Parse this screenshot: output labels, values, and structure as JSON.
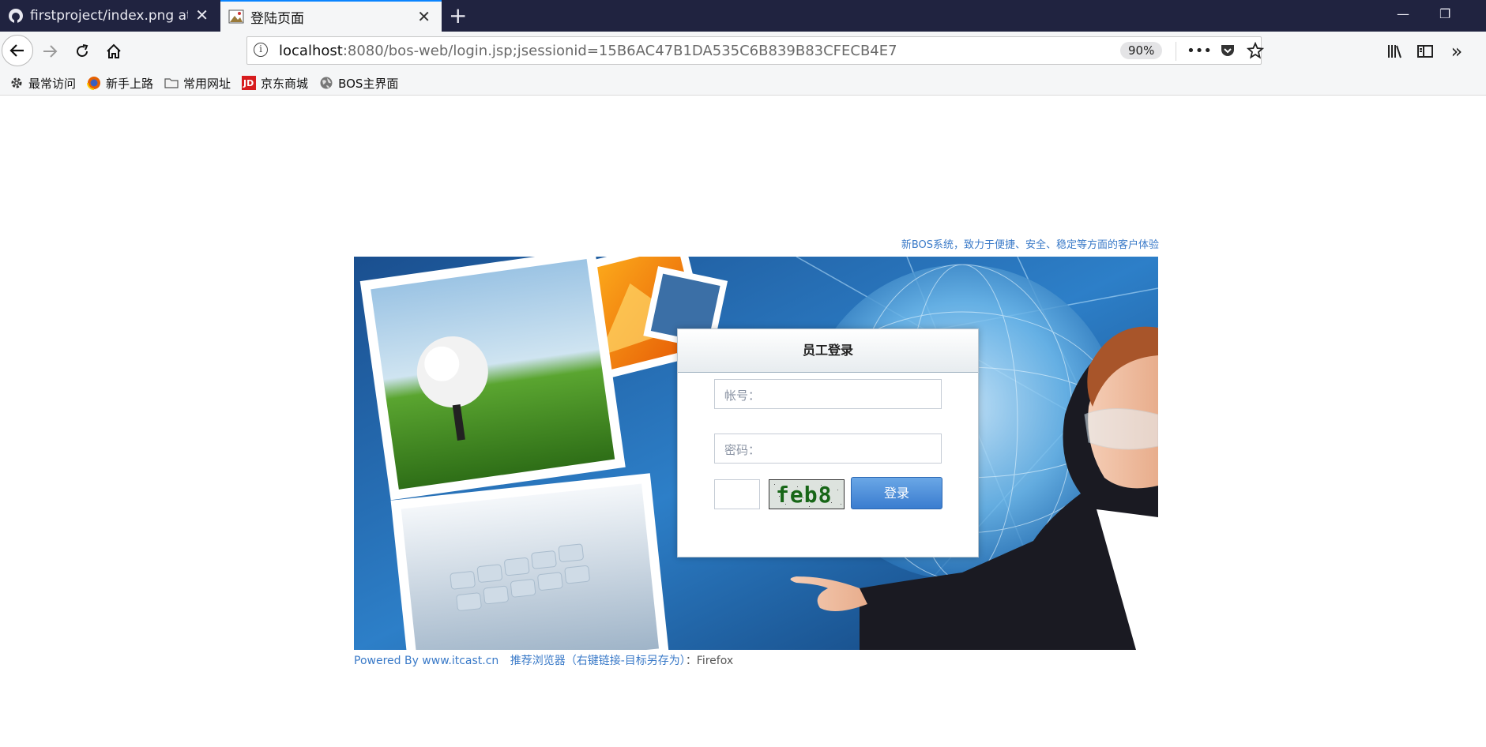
{
  "browser": {
    "tabs": [
      {
        "title": "firstproject/index.png at mas",
        "favicon": "github-icon",
        "active": false
      },
      {
        "title": "登陆页面",
        "favicon": "page-image-icon",
        "active": true
      }
    ],
    "url": {
      "host": "localhost",
      "rest": ":8080/bos-web/login.jsp;jsessionid=15B6AC47B1DA535C6B839B83CFECB4E7"
    },
    "zoom": "90%",
    "bookmarks": [
      {
        "label": "最常访问",
        "icon": "gear-icon"
      },
      {
        "label": "新手上路",
        "icon": "firefox-icon"
      },
      {
        "label": "常用网址",
        "icon": "folder-icon"
      },
      {
        "label": "京东商城",
        "icon": "jd-icon"
      },
      {
        "label": "BOS主界面",
        "icon": "globe-icon"
      }
    ]
  },
  "page": {
    "tagline": "新BOS系统，致力于便捷、安全、稳定等方面的客户体验",
    "login": {
      "title": "员工登录",
      "username_label": "帐号：",
      "password_label": "密码：",
      "captcha_text": "feb8",
      "submit_label": "登录"
    },
    "footer": {
      "powered_by": "Powered By www.itcast.cn",
      "recommend": "推荐浏览器（右键链接-目标另存为）",
      "browser": "：Firefox"
    }
  },
  "colors": {
    "accent": "#3a7ac8",
    "tabbar": "#202340",
    "button": "#4a8ad8"
  }
}
